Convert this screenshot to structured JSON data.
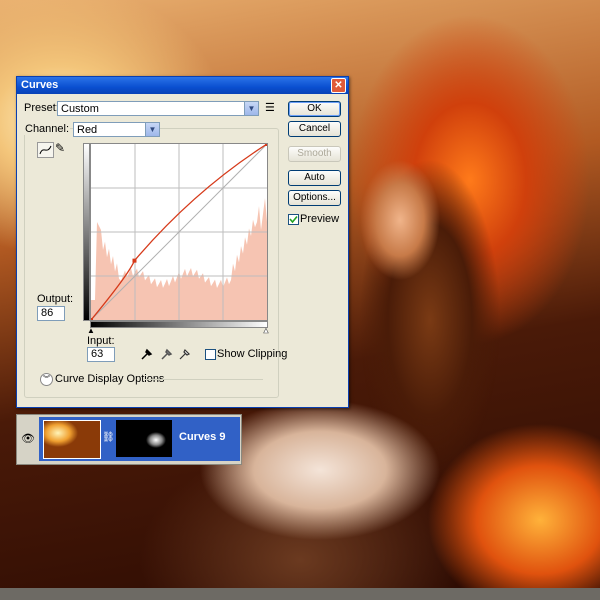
{
  "dialog": {
    "title": "Curves",
    "close_glyph": "✕",
    "preset_label": "Preset:",
    "preset_value": "Custom",
    "channel_label": "Channel:",
    "channel_value": "Red",
    "output_label": "Output:",
    "output_value": "86",
    "input_label": "Input:",
    "input_value": "63",
    "show_clipping_label": "Show Clipping",
    "show_clipping_checked": false,
    "curve_display_options_label": "Curve Display Options",
    "preview_label": "Preview",
    "preview_checked": true
  },
  "buttons": {
    "ok": "OK",
    "cancel": "Cancel",
    "smooth": "Smooth",
    "auto": "Auto",
    "options": "Options..."
  },
  "icons": {
    "curve_tool": "curve-point-tool-icon",
    "pencil_tool": "pencil-tool-icon",
    "preset_menu": "preset-options-menu-icon",
    "black_eyedropper": "black-point-eyedropper-icon",
    "gray_eyedropper": "gray-point-eyedropper-icon",
    "white_eyedropper": "white-point-eyedropper-icon",
    "expand": "expand-chevrons-icon",
    "visibility": "eye-icon",
    "link": "chain-link-icon"
  },
  "layer": {
    "name": "Curves 9"
  },
  "curve": {
    "control_points": [
      [
        0,
        0
      ],
      [
        63,
        86
      ],
      [
        255,
        255
      ]
    ],
    "histogram_color": "#f6c4b2",
    "curve_color": "#d63a1a"
  }
}
